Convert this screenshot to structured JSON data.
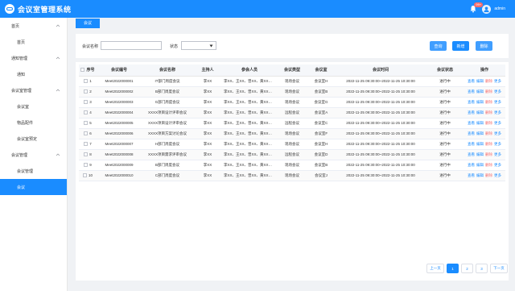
{
  "app": {
    "title": "会议室管理系统",
    "notification_count": "99+",
    "username": "admin"
  },
  "sidebar": {
    "groups": [
      {
        "label": "首页",
        "children": [
          "首页"
        ]
      },
      {
        "label": "通知管理",
        "children": [
          "通知"
        ]
      },
      {
        "label": "会议室管理",
        "children": [
          "会议室",
          "物品配件",
          "会议室预定"
        ]
      },
      {
        "label": "会议管理",
        "children": [
          "会议管理",
          "会议"
        ]
      }
    ],
    "active_item": "会议"
  },
  "tabs": {
    "active": "会议"
  },
  "search": {
    "name_label": "会议名称",
    "name_value": "",
    "name_placeholder": "",
    "status_label": "状态",
    "status_value": "",
    "search_label": "查询",
    "add_label": "新增",
    "delete_label": "删除"
  },
  "table": {
    "columns": [
      "序号",
      "会议编号",
      "会议名称",
      "主持人",
      "参会人员",
      "会议类型",
      "会议室",
      "会议时间",
      "会议状态",
      "操作"
    ],
    "ops": {
      "view": "查看",
      "edit": "编辑",
      "delete": "删除",
      "more": "更多"
    },
    "rows": [
      {
        "no": "1",
        "code": "Meet2022000001",
        "name": "IT部门周度会议",
        "host": "李XX",
        "attendees": "李XX、王XX、曾XX、黄XX、……",
        "type": "现场会议",
        "room": "会议室H",
        "time": "2022-11-25 09:30:00~2022-11-25 10:30:00",
        "status": "进行中"
      },
      {
        "no": "2",
        "code": "Meet2022000002",
        "name": "B部门周度会议",
        "host": "李XX",
        "attendees": "李XX、王XX、曾XX、黄XX、……",
        "type": "现场会议",
        "room": "会议室B",
        "time": "2022-11-25 09:30:00~2022-11-25 10:30:00",
        "status": "进行中"
      },
      {
        "no": "3",
        "code": "Meet2022000003",
        "name": "G部门周度会议",
        "host": "李XX",
        "attendees": "李XX、王XX、曾XX、黄XX、……",
        "type": "现场会议",
        "room": "会议室G",
        "time": "2022-11-25 09:30:00~2022-11-25 10:30:00",
        "status": "进行中"
      },
      {
        "no": "4",
        "code": "Meet2022000004",
        "name": "XXXX项目设计评审会议",
        "host": "李XX",
        "attendees": "李XX、王XX、曾XX、黄XX、……",
        "type": "远程会议",
        "room": "会议室A",
        "time": "2022-11-25 09:30:00~2022-11-25 10:30:00",
        "status": "进行中"
      },
      {
        "no": "5",
        "code": "Meet2022000005",
        "name": "XXXX项目设计评审会议",
        "host": "李XX",
        "attendees": "李XX、王XX、曾XX、黄XX、……",
        "type": "远程会议",
        "room": "会议室C",
        "time": "2022-11-25 09:30:00~2022-11-25 10:30:00",
        "status": "进行中"
      },
      {
        "no": "6",
        "code": "Meet2022000006",
        "name": "XXXX项目方案讨论会议",
        "host": "李XX",
        "attendees": "李XX、王XX、曾XX、黄XX、……",
        "type": "现场会议",
        "room": "会议室F",
        "time": "2022-11-25 09:30:00~2022-11-25 10:30:00",
        "status": "进行中"
      },
      {
        "no": "7",
        "code": "Meet2022000007",
        "name": "H部门周度会议",
        "host": "李XX",
        "attendees": "李XX、王XX、曾XX、黄XX、……",
        "type": "现场会议",
        "room": "会议室H",
        "time": "2022-11-25 09:30:00~2022-11-25 10:30:00",
        "status": "进行中"
      },
      {
        "no": "8",
        "code": "Meet2022000008",
        "name": "XXXX项目需求评审会议",
        "host": "李XX",
        "attendees": "李XX、王XX、曾XX、黄XX、……",
        "type": "远程会议",
        "room": "会议室D",
        "time": "2022-11-25 09:30:00~2022-11-25 10:30:00",
        "status": "进行中"
      },
      {
        "no": "9",
        "code": "Meet2022000009",
        "name": "B部门周度会议",
        "host": "李XX",
        "attendees": "李XX、王XX、曾XX、黄XX、……",
        "type": "现场会议",
        "room": "会议室B",
        "time": "2022-11-25 09:30:00~2022-11-25 10:30:00",
        "status": "进行中"
      },
      {
        "no": "10",
        "code": "Meet2022000010",
        "name": "C部门周度会议",
        "host": "李XX",
        "attendees": "李XX、王XX、曾XX、黄XX、……",
        "type": "现场会议",
        "room": "会议室J",
        "time": "2022-11-25 09:30:00~2022-11-25 10:30:00",
        "status": "进行中"
      }
    ]
  },
  "pagination": {
    "prev": "上一页",
    "pages": [
      "1",
      "2",
      "3"
    ],
    "current": "1",
    "next": "下一页"
  },
  "colors": {
    "primary": "#1a8cff",
    "danger": "#f56c6c"
  }
}
